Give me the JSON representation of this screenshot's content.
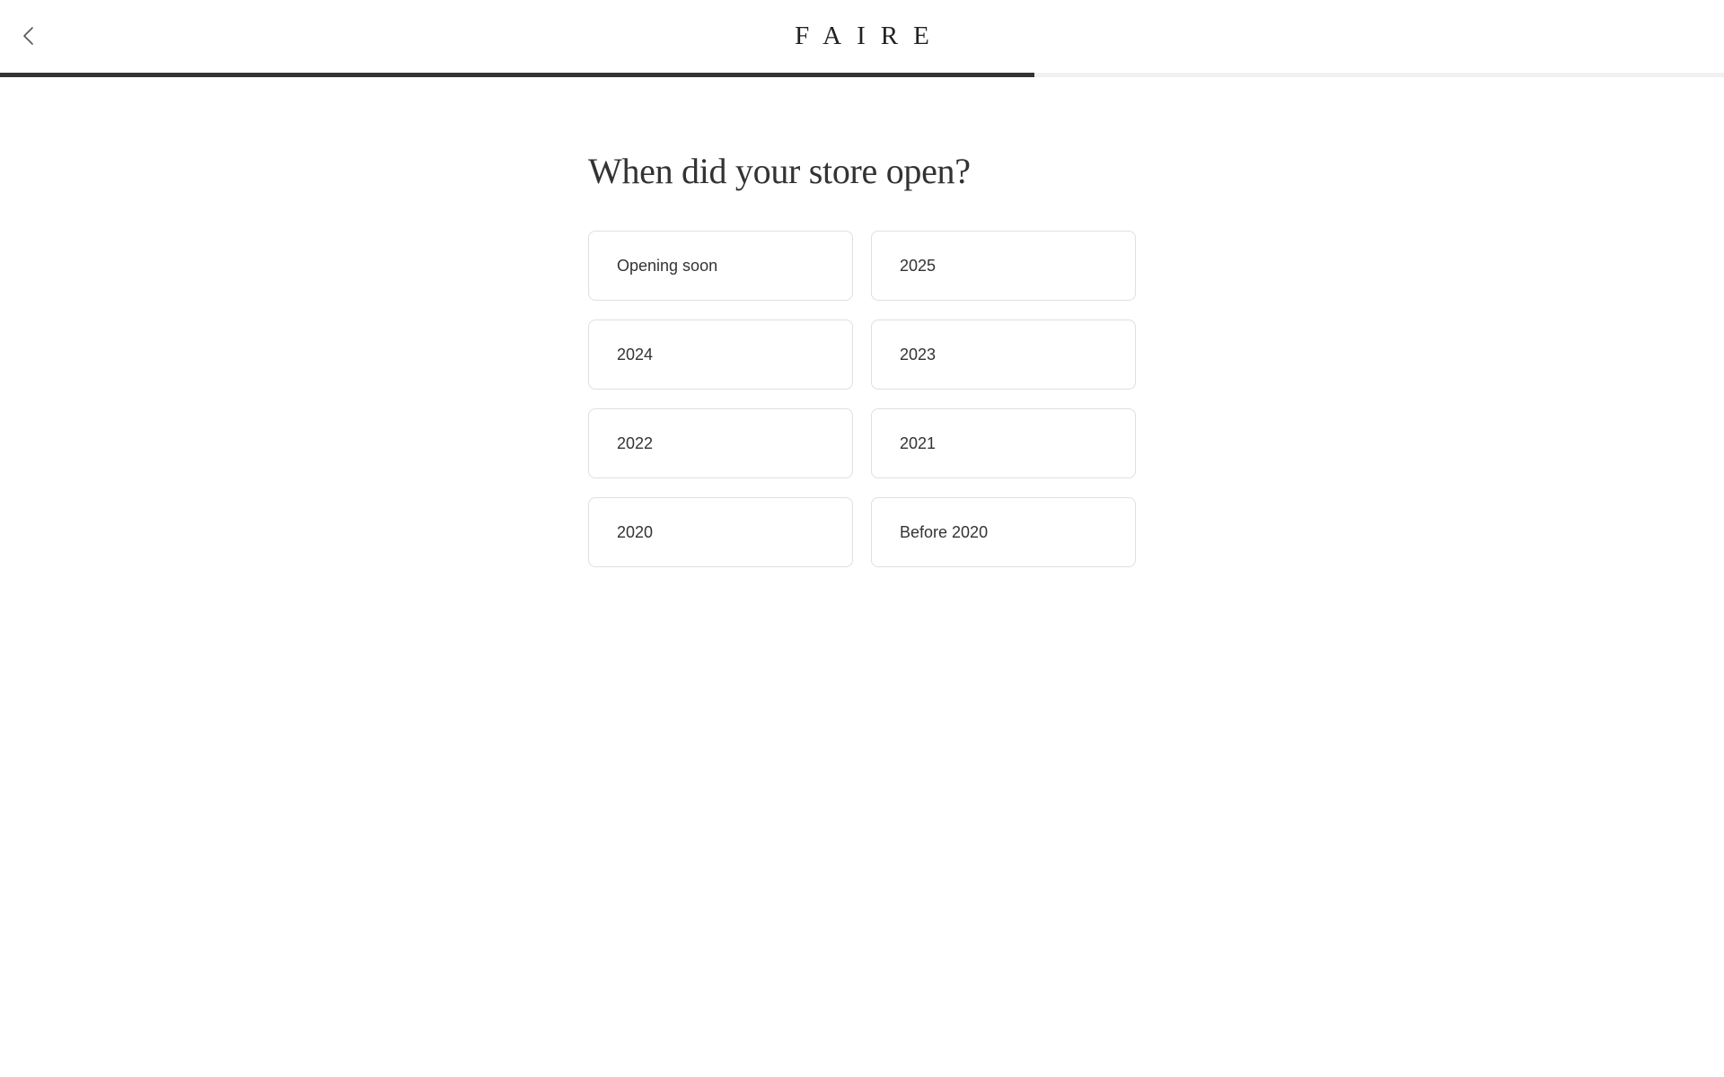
{
  "header": {
    "back_icon": "chevron-left-icon",
    "logo": "FAIRE"
  },
  "progress": {
    "fraction": 0.6
  },
  "main": {
    "question": "When did your store open?",
    "options": [
      {
        "label": "Opening soon"
      },
      {
        "label": "2025"
      },
      {
        "label": "2024"
      },
      {
        "label": "2023"
      },
      {
        "label": "2022"
      },
      {
        "label": "2021"
      },
      {
        "label": "2020"
      },
      {
        "label": "Before 2020"
      }
    ]
  },
  "colors": {
    "progress_fill": "#333333",
    "progress_track": "#f1f1f1",
    "option_border": "#dfdfdf",
    "text": "#333333"
  }
}
